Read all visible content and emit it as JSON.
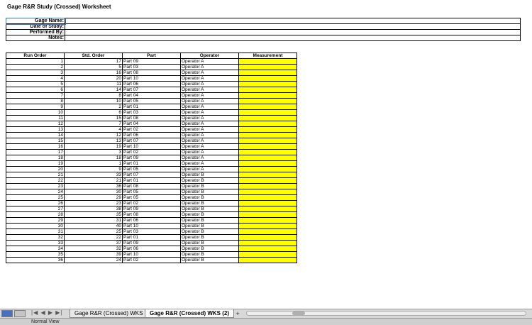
{
  "title": "Gage R&R Study (Crossed) Worksheet",
  "info_labels": [
    "Gage Name:",
    "Date of Study:",
    "Performed By:",
    "Notes:"
  ],
  "columns": [
    "Run Order",
    "Std. Order",
    "Part",
    "Operator",
    "Measurement"
  ],
  "rows": [
    [
      "1",
      "17",
      "Part 09",
      "Operator A"
    ],
    [
      "2",
      "5",
      "Part 03",
      "Operator A"
    ],
    [
      "3",
      "16",
      "Part 08",
      "Operator A"
    ],
    [
      "4",
      "20",
      "Part 10",
      "Operator A"
    ],
    [
      "5",
      "11",
      "Part 06",
      "Operator A"
    ],
    [
      "6",
      "14",
      "Part 07",
      "Operator A"
    ],
    [
      "7",
      "8",
      "Part 04",
      "Operator A"
    ],
    [
      "8",
      "10",
      "Part 05",
      "Operator A"
    ],
    [
      "9",
      "2",
      "Part 01",
      "Operator A"
    ],
    [
      "10",
      "6",
      "Part 03",
      "Operator A"
    ],
    [
      "11",
      "15",
      "Part 08",
      "Operator A"
    ],
    [
      "12",
      "7",
      "Part 04",
      "Operator A"
    ],
    [
      "13",
      "4",
      "Part 02",
      "Operator A"
    ],
    [
      "14",
      "12",
      "Part 06",
      "Operator A"
    ],
    [
      "15",
      "13",
      "Part 07",
      "Operator A"
    ],
    [
      "16",
      "19",
      "Part 10",
      "Operator A"
    ],
    [
      "17",
      "3",
      "Part 02",
      "Operator A"
    ],
    [
      "18",
      "18",
      "Part 09",
      "Operator A"
    ],
    [
      "19",
      "1",
      "Part 01",
      "Operator A"
    ],
    [
      "20",
      "9",
      "Part 05",
      "Operator A"
    ],
    [
      "21",
      "33",
      "Part 07",
      "Operator B"
    ],
    [
      "22",
      "21",
      "Part 01",
      "Operator B"
    ],
    [
      "23",
      "36",
      "Part 08",
      "Operator B"
    ],
    [
      "24",
      "30",
      "Part 05",
      "Operator B"
    ],
    [
      "25",
      "29",
      "Part 05",
      "Operator B"
    ],
    [
      "26",
      "23",
      "Part 02",
      "Operator B"
    ],
    [
      "27",
      "38",
      "Part 09",
      "Operator B"
    ],
    [
      "28",
      "35",
      "Part 08",
      "Operator B"
    ],
    [
      "29",
      "31",
      "Part 06",
      "Operator B"
    ],
    [
      "30",
      "40",
      "Part 10",
      "Operator B"
    ],
    [
      "31",
      "25",
      "Part 03",
      "Operator B"
    ],
    [
      "32",
      "22",
      "Part 01",
      "Operator B"
    ],
    [
      "33",
      "37",
      "Part 09",
      "Operator B"
    ],
    [
      "34",
      "32",
      "Part 06",
      "Operator B"
    ],
    [
      "35",
      "39",
      "Part 10",
      "Operator B"
    ],
    [
      "36",
      "24",
      "Part 02",
      "Operator B"
    ]
  ],
  "tabs": [
    "Gage R&R (Crossed) WKS",
    "Gage R&R (Crossed) WKS (2)"
  ],
  "add_tab": "+",
  "nav_arrows": "|◀ ◀ ▶ ▶|",
  "status": "Normal View",
  "colors": {
    "measurement_fill": "#ffff00",
    "selection": "#3a6fd8"
  }
}
